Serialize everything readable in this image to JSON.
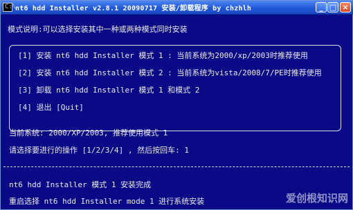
{
  "window": {
    "title": "nt6 hdd Installer v2.8.1 20090717 安装/卸载程序 by chzhlh",
    "buttons": {
      "minimize": "_",
      "maximize": "□",
      "close": "×"
    }
  },
  "console": {
    "mode_desc": "模式说明:可以选择安装其中一种或两种模式同时安装",
    "menu": [
      "[1] 安装 nt6 hdd Installer 模式 1 : 当前系统为2000/xp/2003时推荐使用",
      "[2] 安装 nt6 hdd Installer 模式 2 : 当前系统为vista/2008/7/PE时推荐使用",
      "[3] 卸载 nt6 hdd Installer 模式 1 和模式 2",
      "[4] 退出 [Quit]"
    ],
    "current_system": "当前系统: 2000/XP/2003, 推荐使用模式 1",
    "prompt": "请选择要进行的操作 [1/2/3/4] , 然后按回车: 1",
    "result": "nt6 hdd Installer 模式 1 安装完成",
    "restart_hint": "重启选择 nt6 hdd Installer mode 1 进行系统安装"
  },
  "watermark": "爱创根知识网"
}
